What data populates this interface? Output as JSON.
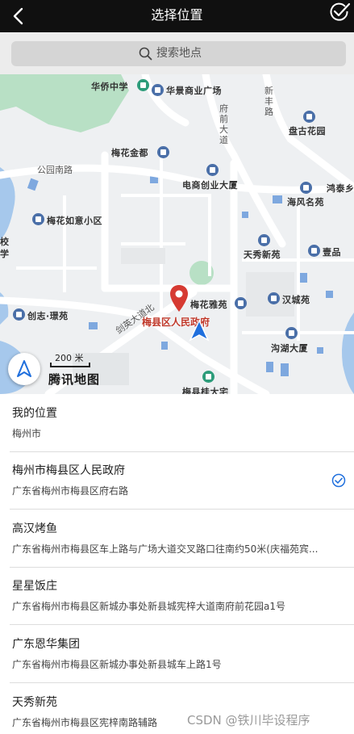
{
  "header": {
    "title": "选择位置",
    "back_icon": "chevron-left-icon",
    "confirm_icon": "check-circle-icon"
  },
  "search": {
    "placeholder": "搜索地点",
    "icon": "search-icon"
  },
  "map": {
    "selected_label": "梅县区人民政府",
    "scale_text": "200 米",
    "brand": "腾讯地图",
    "colors": {
      "water": "#a6c8ec",
      "green": "#b8e0c5",
      "road": "#ffffff",
      "pin": "#d63a32",
      "arrow": "#1f6fdd"
    },
    "labels": {
      "huaqiao": "华侨中学",
      "huajing": "华景商业广场",
      "xinfeng": "新丰路",
      "fuqian": "府前大道",
      "panhu": "盘古花园",
      "meihuajindu": "梅花金都",
      "gongyuan": "公园南路",
      "dianshang": "电商创业大厦",
      "hongtai": "鸿泰乡",
      "haifeng": "海风名苑",
      "meihuaruyi": "梅花如意小区",
      "xiao": "校",
      "xue": "学",
      "tianxiu": "天秀新苑",
      "yipin": "壹品",
      "meihuaya": "梅花雅苑",
      "hancheng": "汉城苑",
      "chuangzhi": "创志·璟苑",
      "jianying": "剑英大道北",
      "xunhu": "沟湖大厦",
      "meixian": "梅县桂大宅"
    }
  },
  "locations": [
    {
      "name": "我的位置",
      "address": "梅州市",
      "selected": false
    },
    {
      "name": "梅州市梅县区人民政府",
      "address": "广东省梅州市梅县区府右路",
      "selected": true
    },
    {
      "name": "高汉烤鱼",
      "address": "广东省梅州市梅县区车上路与广场大道交叉路口往南约50米(庆福苑宾...",
      "selected": false
    },
    {
      "name": "星星饭庄",
      "address": "广东省梅州市梅县区新城办事处新县城宪梓大道南府前花园a1号",
      "selected": false
    },
    {
      "name": "广东恩华集团",
      "address": "广东省梅州市梅县区新城办事处新县城车上路1号",
      "selected": false
    },
    {
      "name": "天秀新苑",
      "address": "广东省梅州市梅县区宪梓南路辅路",
      "selected": false
    }
  ],
  "watermark": "CSDN @铁川毕设程序"
}
